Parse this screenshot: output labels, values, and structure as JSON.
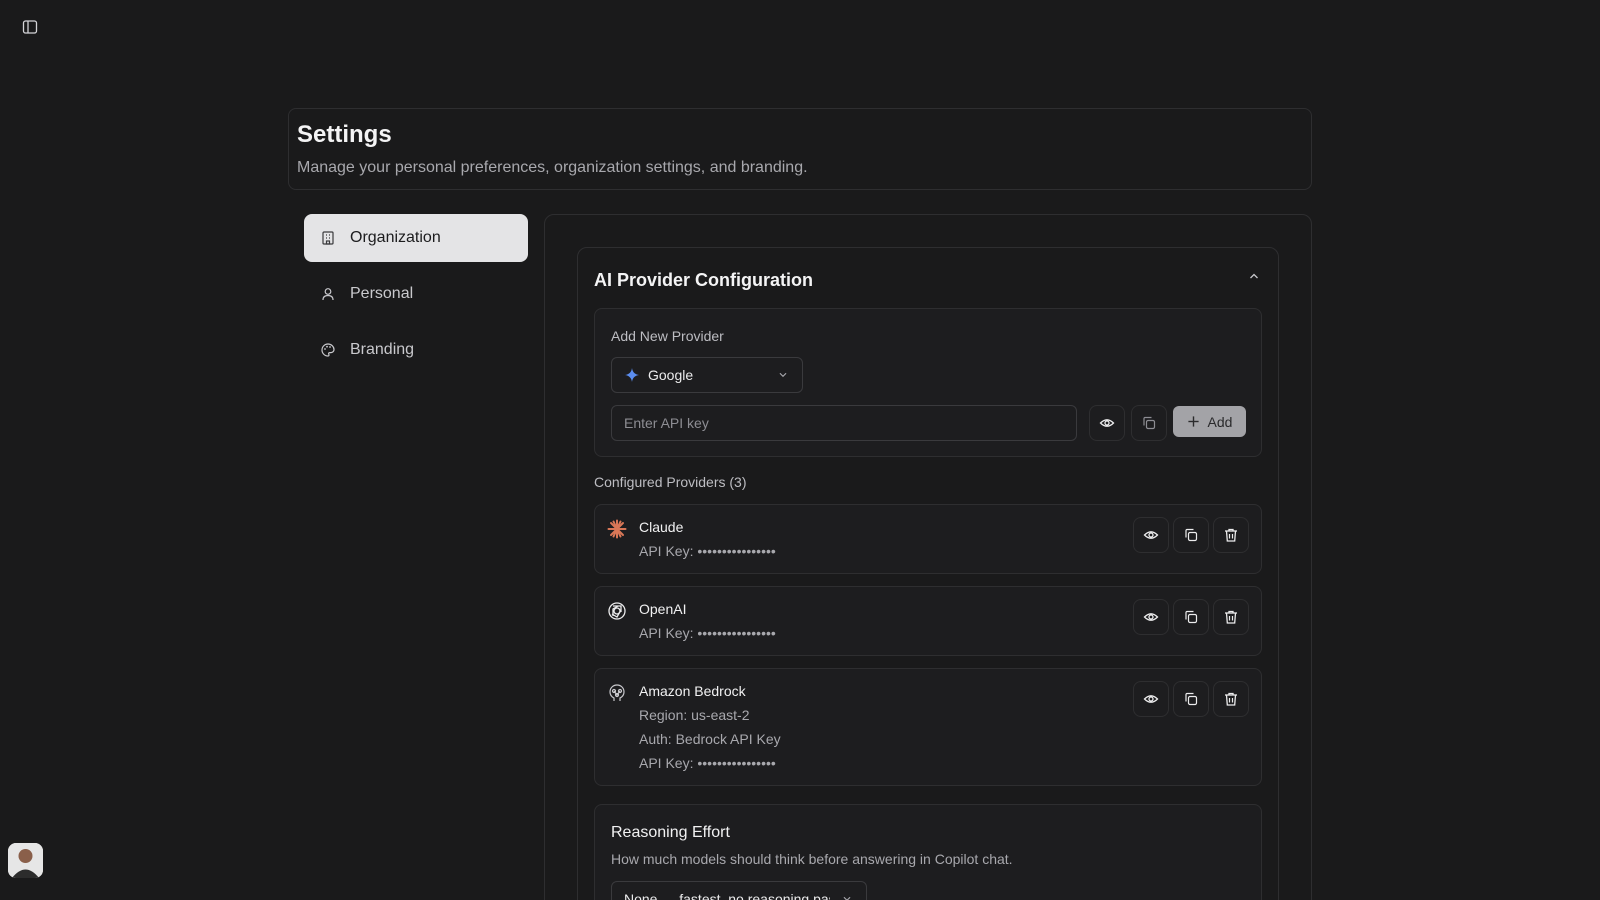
{
  "header": {
    "title": "Settings",
    "subtitle": "Manage your personal preferences, organization settings, and branding."
  },
  "nav": {
    "items": [
      {
        "label": "Organization",
        "icon": "building-icon",
        "active": true
      },
      {
        "label": "Personal",
        "icon": "user-icon",
        "active": false
      },
      {
        "label": "Branding",
        "icon": "palette-icon",
        "active": false
      }
    ]
  },
  "ai_provider": {
    "title": "AI Provider Configuration",
    "add_new": {
      "label": "Add New Provider",
      "selected_provider": "Google",
      "api_key_placeholder": "Enter API key",
      "add_label": "Add"
    },
    "configured_label": "Configured Providers (3)",
    "providers": [
      {
        "name": "Claude",
        "icon": "claude-icon",
        "lines": [
          "API Key: ••••••••••••••••"
        ]
      },
      {
        "name": "OpenAI",
        "icon": "openai-icon",
        "lines": [
          "API Key: ••••••••••••••••"
        ]
      },
      {
        "name": "Amazon Bedrock",
        "icon": "bedrock-icon",
        "lines": [
          "Region: us-east-2",
          "Auth: Bedrock API Key",
          "API Key: ••••••••••••••••"
        ]
      }
    ]
  },
  "reasoning": {
    "title": "Reasoning Effort",
    "description": "How much models should think before answering in Copilot chat.",
    "selected": "None — fastest, no reasoning pass"
  },
  "colors": {
    "background": "#1a1a1b",
    "claude_accent": "#d97757",
    "google_accent": "#5b8def"
  }
}
